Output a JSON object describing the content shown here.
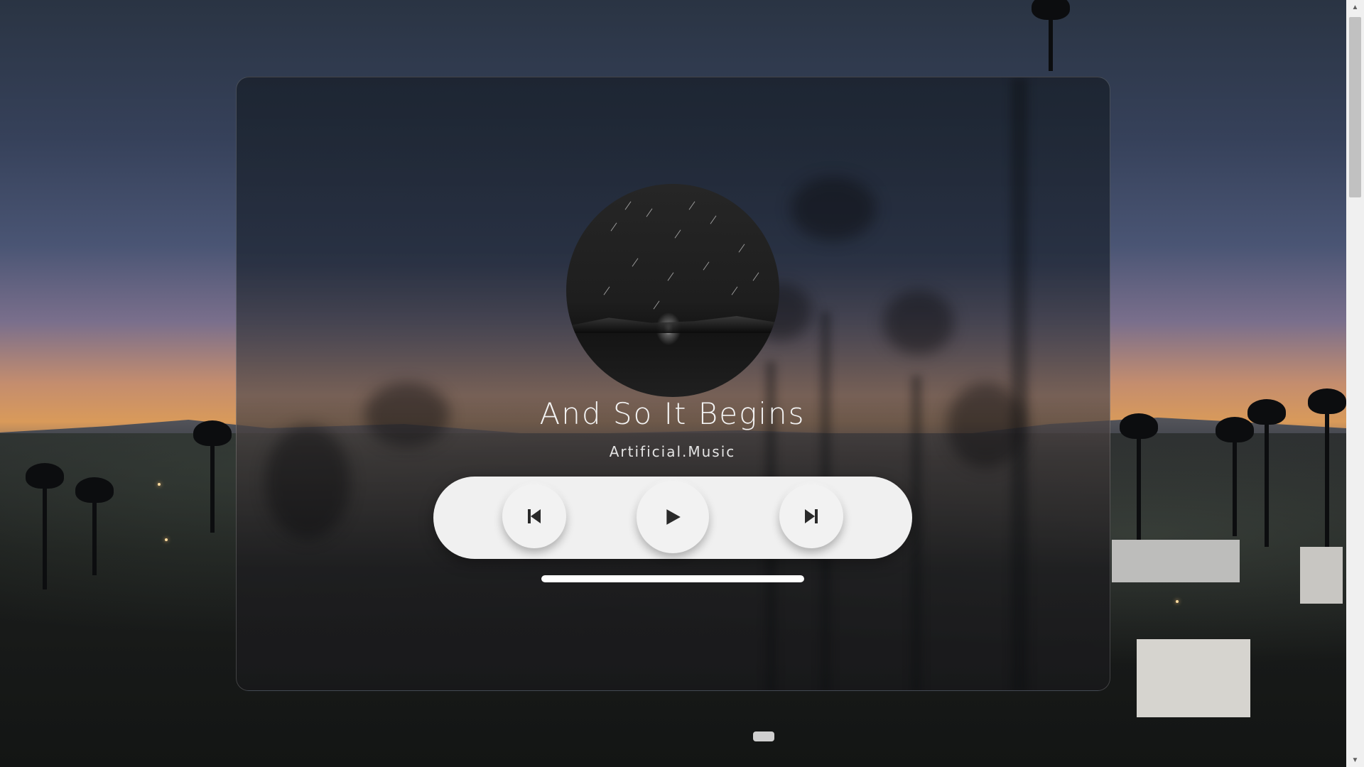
{
  "track": {
    "title": "And So It Begins",
    "artist": "Artificial.Music",
    "progress_fraction": 1.0
  },
  "controls": {
    "prev_icon": "skip-previous-icon",
    "play_icon": "play-icon",
    "next_icon": "skip-next-icon"
  },
  "colors": {
    "control_bg": "#f0f0f0",
    "icon": "#2a2a2a",
    "text": "#f3f3f3"
  }
}
